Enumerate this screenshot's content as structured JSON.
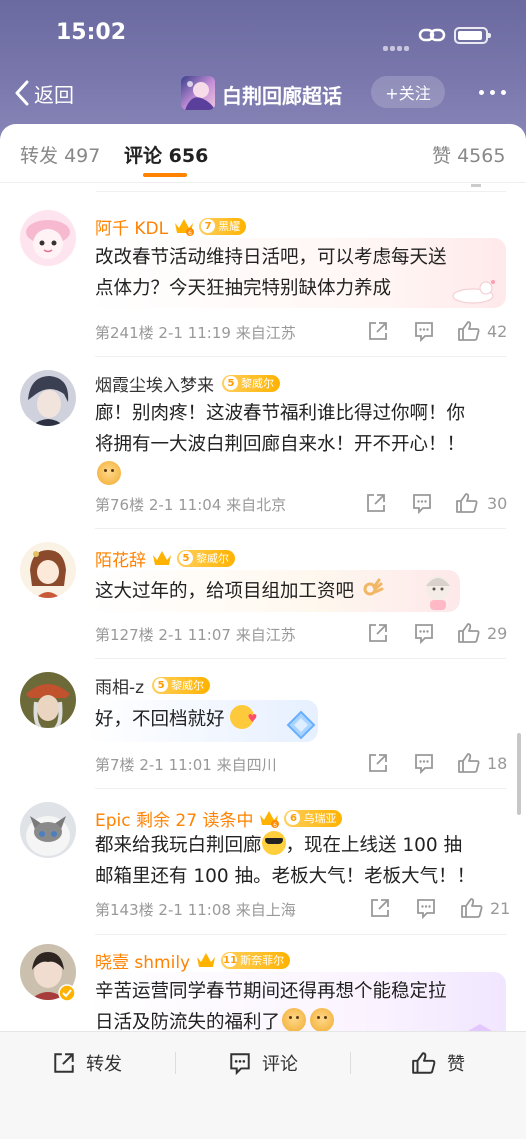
{
  "status_bar": {
    "time": "15:02"
  },
  "nav": {
    "back_label": "返回",
    "title": "白荆回廊超话",
    "follow_label": "+关注"
  },
  "tabs": [
    {
      "label": "转发",
      "count": "497"
    },
    {
      "label": "评论",
      "count": "656"
    },
    {
      "label": "赞",
      "count": "4565"
    }
  ],
  "comments": [
    {
      "user": "阿千 KDL",
      "vip_level": "6",
      "fan_level": "7",
      "fan_title": "黑耀",
      "lines": [
        "改改春节活动维持日活吧，可以考虑每天送",
        "点体力？今天狂抽完特别缺体力养成"
      ],
      "floor": "第241楼",
      "time": "2-1 11:19",
      "location": "来自江苏",
      "likes": "42"
    },
    {
      "user": "烟霞尘埃入梦来",
      "fan_level": "5",
      "fan_title": "黎威尔",
      "lines": [
        "廊！别肉疼！这波春节福利谁比得过你啊！你",
        "将拥有一大波白荆回廊自来水！开不开心！！"
      ],
      "floor": "第76楼",
      "time": "2-1 11:04",
      "location": "来自北京",
      "likes": "30"
    },
    {
      "user": "陌花辞",
      "fan_level": "5",
      "fan_title": "黎威尔",
      "lines": [
        "这大过年的，给项目组加工资吧"
      ],
      "floor": "第127楼",
      "time": "2-1 11:07",
      "location": "来自江苏",
      "likes": "29"
    },
    {
      "user": "雨相-z",
      "fan_level": "5",
      "fan_title": "黎威尔",
      "lines": [
        "好，不回档就好"
      ],
      "floor": "第7楼",
      "time": "2-1 11:01",
      "location": "来自四川",
      "likes": "18"
    },
    {
      "user": "Epic 剩余 27 读条中",
      "vip_level": "6",
      "fan_level": "6",
      "fan_title": "乌瑞亚",
      "line1_before": "都来给我玩白荆回廊",
      "line1_after": "，现在上线送 100 抽",
      "line2": "邮箱里还有 100 抽。老板大气！老板大气！！",
      "floor": "第143楼",
      "time": "2-1 11:08",
      "location": "来自上海",
      "likes": "21"
    },
    {
      "user": "晓壹 shmily",
      "fan_level": "11",
      "fan_title": "斯奈菲尔",
      "lines": [
        "辛苦运营同学春节期间还得再想个能稳定拉",
        "日活及防流失的福利了"
      ]
    }
  ],
  "bottom_bar": {
    "repost": "转发",
    "comment": "评论",
    "like": "赞"
  },
  "colors": {
    "accent": "#ff8200",
    "header": "#7a78ad"
  }
}
